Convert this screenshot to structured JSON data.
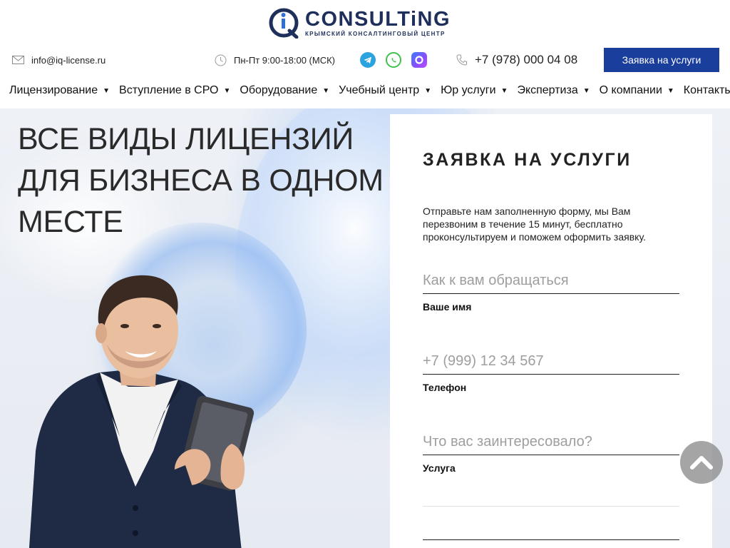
{
  "logo": {
    "letters": "iQ",
    "title": "CONSULTiNG",
    "subtitle": "Крымский консалтинговый центр"
  },
  "topbar": {
    "email": "info@iq-license.ru",
    "hours": "Пн-Пт 9:00-18:00 (МСК)",
    "phone": "+7 (978) 000 04 08",
    "social": [
      "telegram-icon",
      "whatsapp-icon",
      "max-messenger-icon"
    ],
    "cta_label": "Заявка на услуги"
  },
  "nav": {
    "items": [
      {
        "label": "Лицензирование",
        "dropdown": true
      },
      {
        "label": "Вступление в СРО",
        "dropdown": true
      },
      {
        "label": "Оборудование",
        "dropdown": true
      },
      {
        "label": "Учебный центр",
        "dropdown": true
      },
      {
        "label": "Юр услуги",
        "dropdown": true
      },
      {
        "label": "Экспертиза",
        "dropdown": true
      },
      {
        "label": "О компании",
        "dropdown": true
      },
      {
        "label": "Контакты",
        "dropdown": false
      }
    ]
  },
  "hero": {
    "title": "Все виды лицензий для бизнеса в одном месте"
  },
  "form": {
    "title": "Заявка на услуги",
    "description": "Отправьте нам заполненную форму, мы Вам перезвоним в течение 15 минут, бесплатно проконсультируем и поможем оформить заявку.",
    "name_placeholder": "Как к вам обращаться",
    "name_label": "Ваше имя",
    "phone_placeholder": "+7 (999) 12 34 567",
    "phone_label": "Телефон",
    "service_placeholder": "Что вас заинтересовало?",
    "service_label": "Услуга"
  },
  "colors": {
    "brand_blue": "#1a3e9c",
    "logo_navy": "#1f2f5c",
    "telegram": "#2aa3de",
    "whatsapp": "#3ec24c"
  }
}
